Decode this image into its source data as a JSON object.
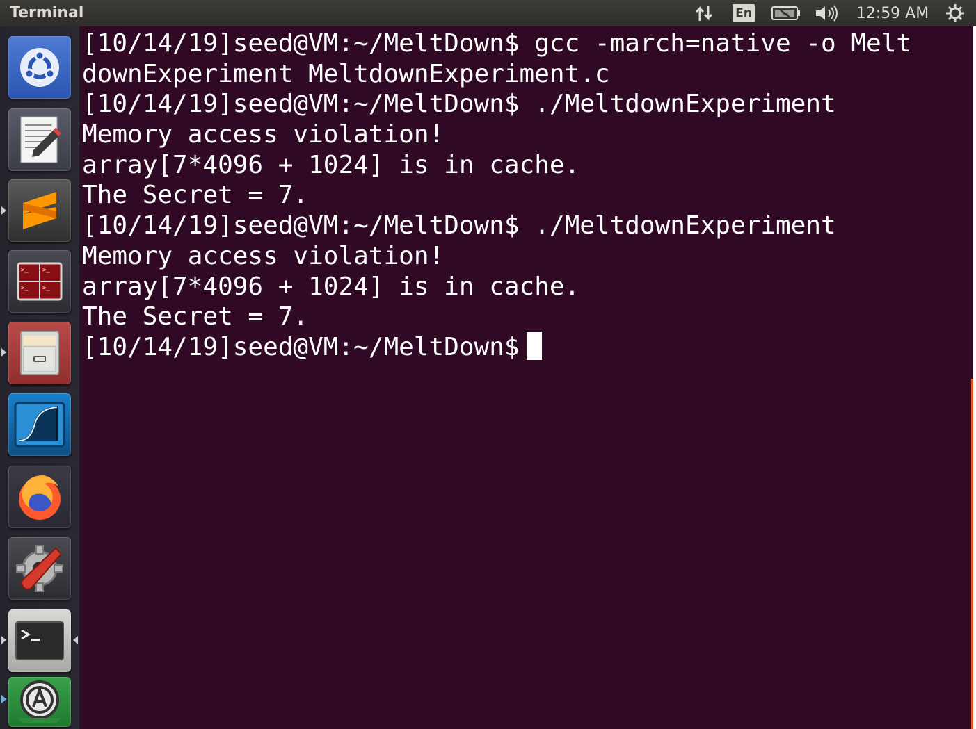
{
  "topbar": {
    "title": "Terminal",
    "input_language": "En",
    "clock": "12:59 AM"
  },
  "launcher": {
    "items": [
      {
        "name": "dash-home",
        "icon": "ubuntu-logo-icon"
      },
      {
        "name": "text-editor",
        "icon": "text-editor-icon"
      },
      {
        "name": "sublime-text",
        "icon": "sublime-text-icon"
      },
      {
        "name": "terminator",
        "icon": "terminator-icon"
      },
      {
        "name": "files",
        "icon": "file-cabinet-icon"
      },
      {
        "name": "wireshark",
        "icon": "wireshark-fin-icon"
      },
      {
        "name": "firefox",
        "icon": "firefox-icon"
      },
      {
        "name": "system-settings",
        "icon": "settings-wrench-icon"
      },
      {
        "name": "terminal",
        "icon": "terminal-icon"
      },
      {
        "name": "software-updater",
        "icon": "software-updater-icon"
      }
    ]
  },
  "terminal": {
    "lines": [
      "[10/14/19]seed@VM:~/MeltDown$ gcc -march=native -o Melt",
      "downExperiment MeltdownExperiment.c",
      "[10/14/19]seed@VM:~/MeltDown$ ./MeltdownExperiment",
      "Memory access violation!",
      "array[7*4096 + 1024] is in cache.",
      "The Secret = 7.",
      "[10/14/19]seed@VM:~/MeltDown$ ./MeltdownExperiment",
      "Memory access violation!",
      "array[7*4096 + 1024] is in cache.",
      "The Secret = 7."
    ],
    "prompt": "[10/14/19]seed@VM:~/MeltDown$"
  },
  "colors": {
    "terminal_bg": "#300a24",
    "accent": "#e95420"
  }
}
